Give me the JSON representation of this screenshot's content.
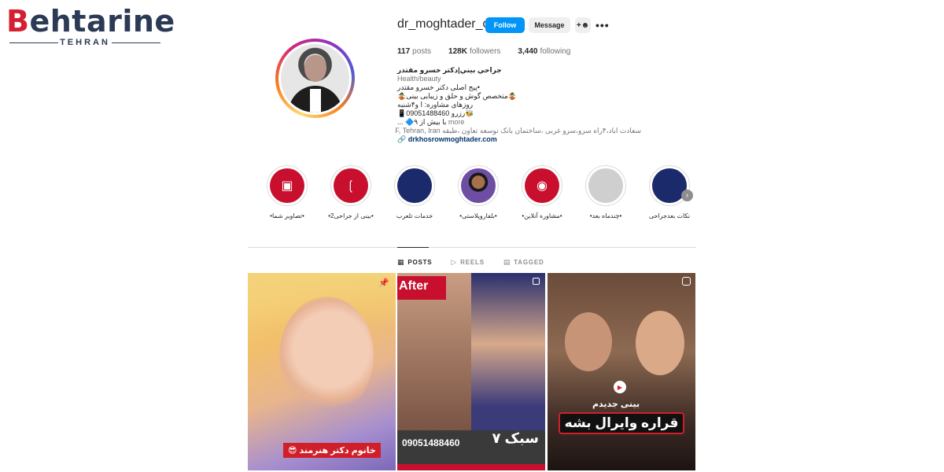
{
  "watermark": {
    "brand_b": "B",
    "brand_rest": "ehtarine",
    "city": "TEHRAN"
  },
  "profile": {
    "username": "dr_moghtader_org",
    "follow_label": "Follow",
    "message_label": "Message",
    "stats": {
      "posts_count": "117",
      "posts_label": "posts",
      "followers_count": "128K",
      "followers_label": "followers",
      "following_count": "3,440",
      "following_label": "following"
    },
    "bio": {
      "name": "جراحي بيني|دكتر خسرو مقتدر",
      "category": "Health/beauty",
      "line1": "•پيج اصلی دكتر خسرو مقتدر",
      "line2": "🤹متخصص گوش و حلق و زيبايی بينی🤹",
      "line3": "روزهای مشاوره: ا و۴شنبه",
      "line4": "🐝رزرو 09051488460📱",
      "line5": "با بيش از ۹🔷 ...",
      "more": "more",
      "address": "سعادت اباد،۴راه سرو،سرو غربی ،ساختمان بانک توسعه تعاون ،طبقه F, Tehran, Iran",
      "link": "drkhosrowmoghtader.com"
    }
  },
  "highlights": [
    {
      "label": "•تصاوير شما•",
      "style": "red",
      "icon": "gallery-icon"
    },
    {
      "label": "•بينی از جراحی2•",
      "style": "red",
      "icon": "nose-icon"
    },
    {
      "label": "خدمات تلعرب",
      "style": "navy",
      "icon": ""
    },
    {
      "label": "•بلفاروپلاستی•",
      "style": "face",
      "icon": ""
    },
    {
      "label": "•مشاوره آنلاين•",
      "style": "red",
      "icon": "globe-icon"
    },
    {
      "label": "•چندماه بعد•",
      "style": "gray",
      "icon": ""
    },
    {
      "label": "نكات بعدجراحی",
      "style": "navy",
      "icon": ""
    }
  ],
  "tabs": [
    {
      "label": "POSTS",
      "icon": "grid-icon",
      "active": true
    },
    {
      "label": "REELS",
      "icon": "reels-icon",
      "active": false
    },
    {
      "label": "TAGGED",
      "icon": "tag-icon",
      "active": false
    }
  ],
  "posts": {
    "p1": {
      "caption": "خانوم دكتر هنرمند 😎",
      "icon": "pin-icon"
    },
    "p2": {
      "after": "After",
      "phone": "09051488460",
      "style_text": "سبک ۷",
      "icon": "album-icon"
    },
    "p3": {
      "sub": "بينی جديدم",
      "main": "قراره وايرال بشه",
      "icon": "reel-icon"
    }
  },
  "colors": {
    "follow": "#0095f6",
    "brand_red": "#c8102e"
  }
}
